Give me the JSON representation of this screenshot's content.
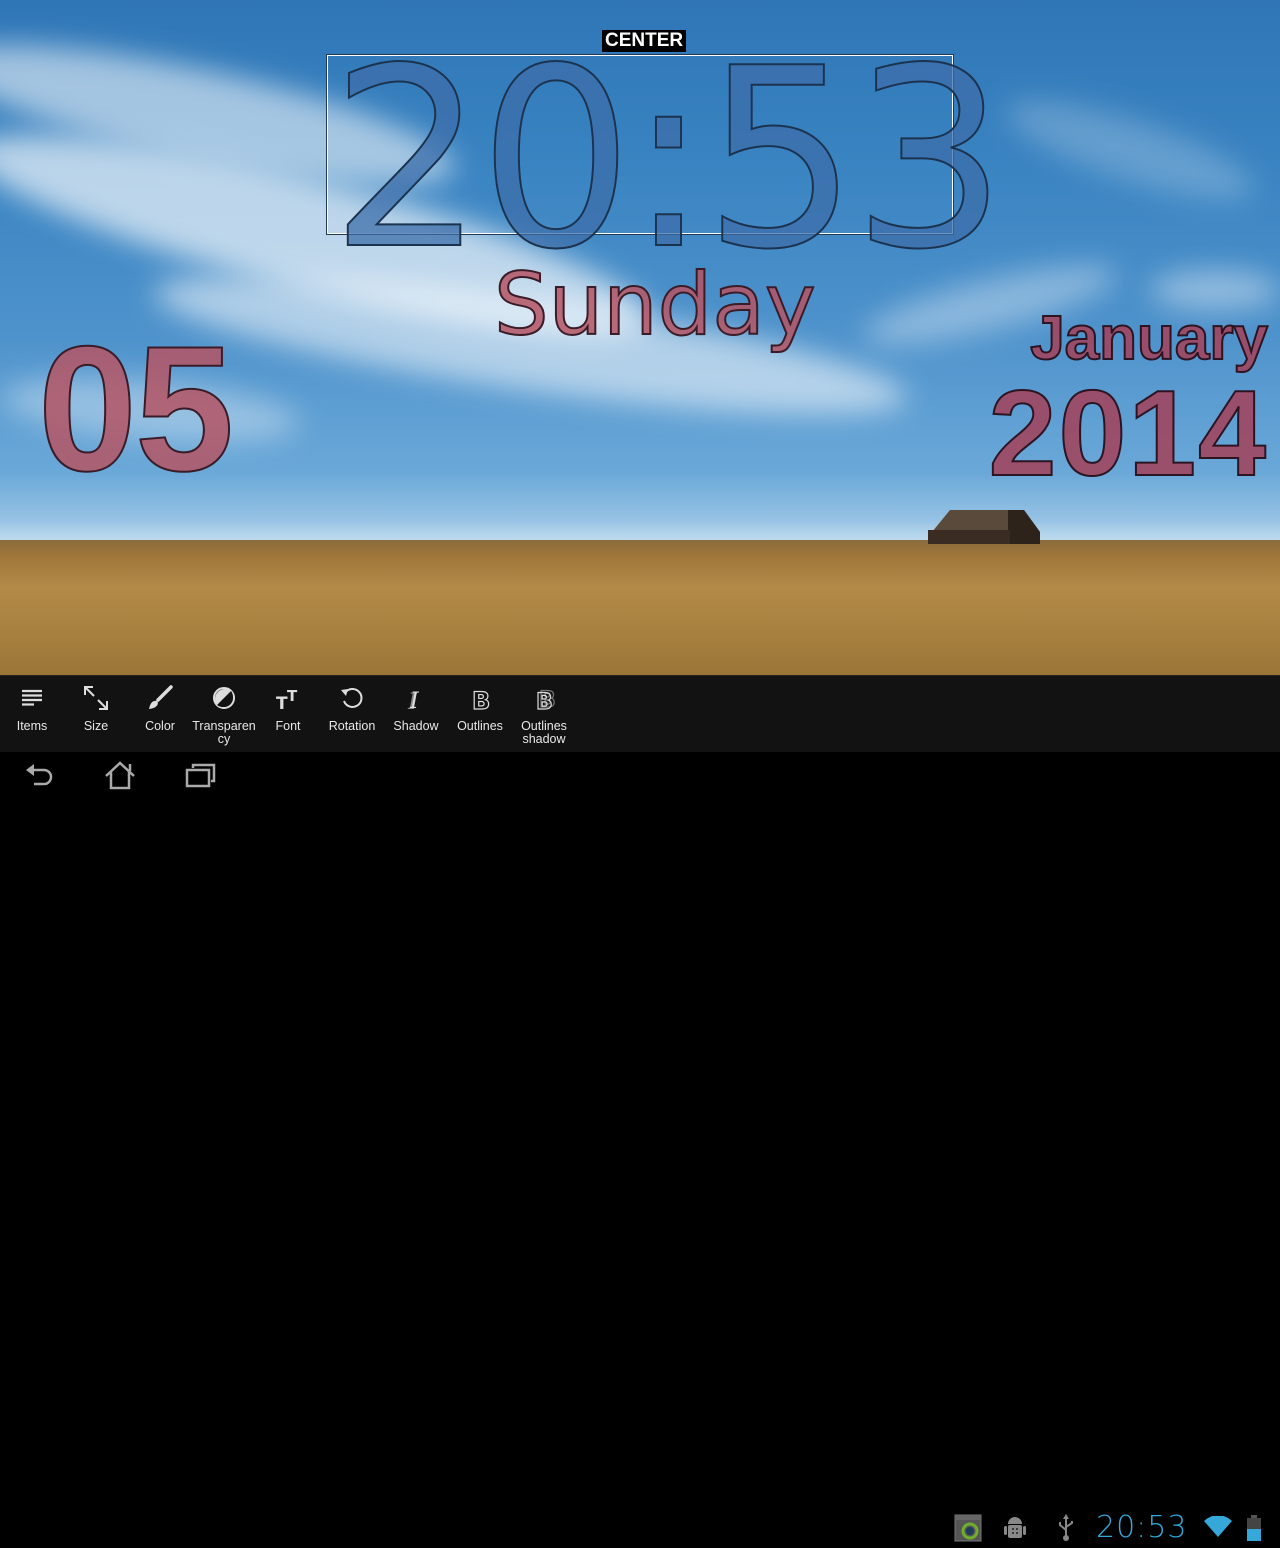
{
  "widget": {
    "alignment_label": "CENTER",
    "time": "20:53",
    "day_of_week": "Sunday",
    "day_of_month": "05",
    "month": "January",
    "year": "2014",
    "colors": {
      "time_fill": "#3c6eaa",
      "date_fill": "#b45564",
      "outline": "#1c3350"
    }
  },
  "toolbar": {
    "items": [
      {
        "label": "Items",
        "icon": "list-icon"
      },
      {
        "label": "Size",
        "icon": "resize-icon"
      },
      {
        "label": "Color",
        "icon": "brush-icon"
      },
      {
        "label": "Transparen cy",
        "icon": "contrast-icon"
      },
      {
        "label": "Font",
        "icon": "font-size-icon"
      },
      {
        "label": "Rotation",
        "icon": "rotate-icon"
      },
      {
        "label": "Shadow",
        "icon": "italic-shadow-icon"
      },
      {
        "label": "Outlines",
        "icon": "bold-outline-icon"
      },
      {
        "label": "Outlines shadow",
        "icon": "bold-outline-shadow-icon"
      }
    ]
  },
  "navbar": {
    "back": "back-icon",
    "home": "home-icon",
    "recents": "recent-apps-icon"
  },
  "status_bar": {
    "clock": "20:53",
    "icons": [
      "app-sync-notification-icon",
      "android-debug-icon",
      "usb-icon",
      "wifi-icon",
      "battery-icon"
    ],
    "accent_color": "#35a7d8"
  }
}
